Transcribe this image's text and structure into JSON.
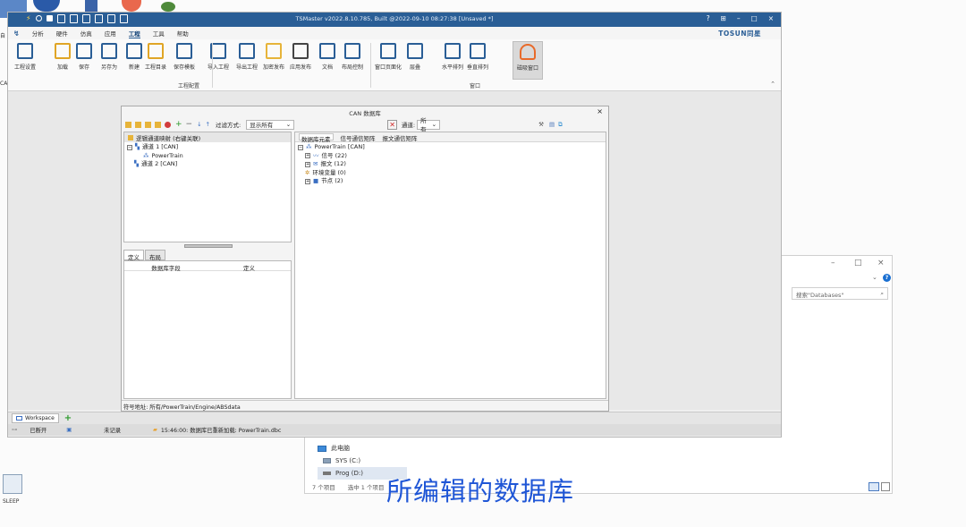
{
  "app": {
    "title": "TSMaster v2022.8.10.785, Built @2022-09-10 08:27:38 [Unsaved *]",
    "brand": "TOSUN同星",
    "window_buttons": [
      "?",
      "⊞",
      "–",
      "□",
      "×"
    ]
  },
  "menu": [
    "分析",
    "硬件",
    "仿真",
    "应用",
    "工程",
    "工具",
    "帮助"
  ],
  "menu_active": "工程",
  "ribbon": {
    "buttons": [
      "工程设置",
      "加载",
      "保存",
      "另存为",
      "新建",
      "工程目录",
      "保存模板",
      "导入工程",
      "导出工程",
      "加密发布",
      "应用发布",
      "文档",
      "布局控制",
      "窗口页面化",
      "层叠",
      "水平排列",
      "垂直排列",
      "磁吸窗口"
    ],
    "groups": [
      "工程配置",
      "窗口"
    ]
  },
  "dialog": {
    "title": "CAN 数据库",
    "filter_label": "过滤方式:",
    "filter_value": "显示所有",
    "channel_label": "通道:",
    "channel_value": "所有",
    "left_header": "逻辑通道映射 (右键关联)",
    "left_tree": [
      "通道 1 [CAN]",
      "PowerTrain",
      "通道 2 [CAN]"
    ],
    "def_tabs": [
      "定义",
      "布局"
    ],
    "def_columns": [
      "数据库字段",
      "定义"
    ],
    "right_tabs": [
      "数据库元素",
      "信号通信矩阵",
      "报文通信矩阵"
    ],
    "right_tree": [
      "PowerTrain [CAN]",
      "信号 (22)",
      "报文 (12)",
      "环境变量 (0)",
      "节点 (2)"
    ],
    "status": "符号地址: 所有/PowerTrain/Engine/ABSdata"
  },
  "workspace_tab": "Workspace",
  "statusbar": {
    "connection": "已断开",
    "record": "未记录",
    "log": "15:46:00: 数据库已重新加载: PowerTrain.dbc"
  },
  "explorer": {
    "search_placeholder": "搜索\"Databases\"",
    "nav": [
      "此电脑",
      "SYS (C:)",
      "Prog (D:)"
    ],
    "status_count": "7 个项目",
    "status_selected": "选中 1 个项目"
  },
  "desktop": {
    "sleep_label": "SLEEP",
    "side_labels": [
      "自",
      "CAI"
    ]
  },
  "subtitle": "所编辑的数据库",
  "colors": {
    "title_bar": "#2a5e96",
    "subtitle": "#1f56d6",
    "accent_orange": "#e86a2a"
  }
}
